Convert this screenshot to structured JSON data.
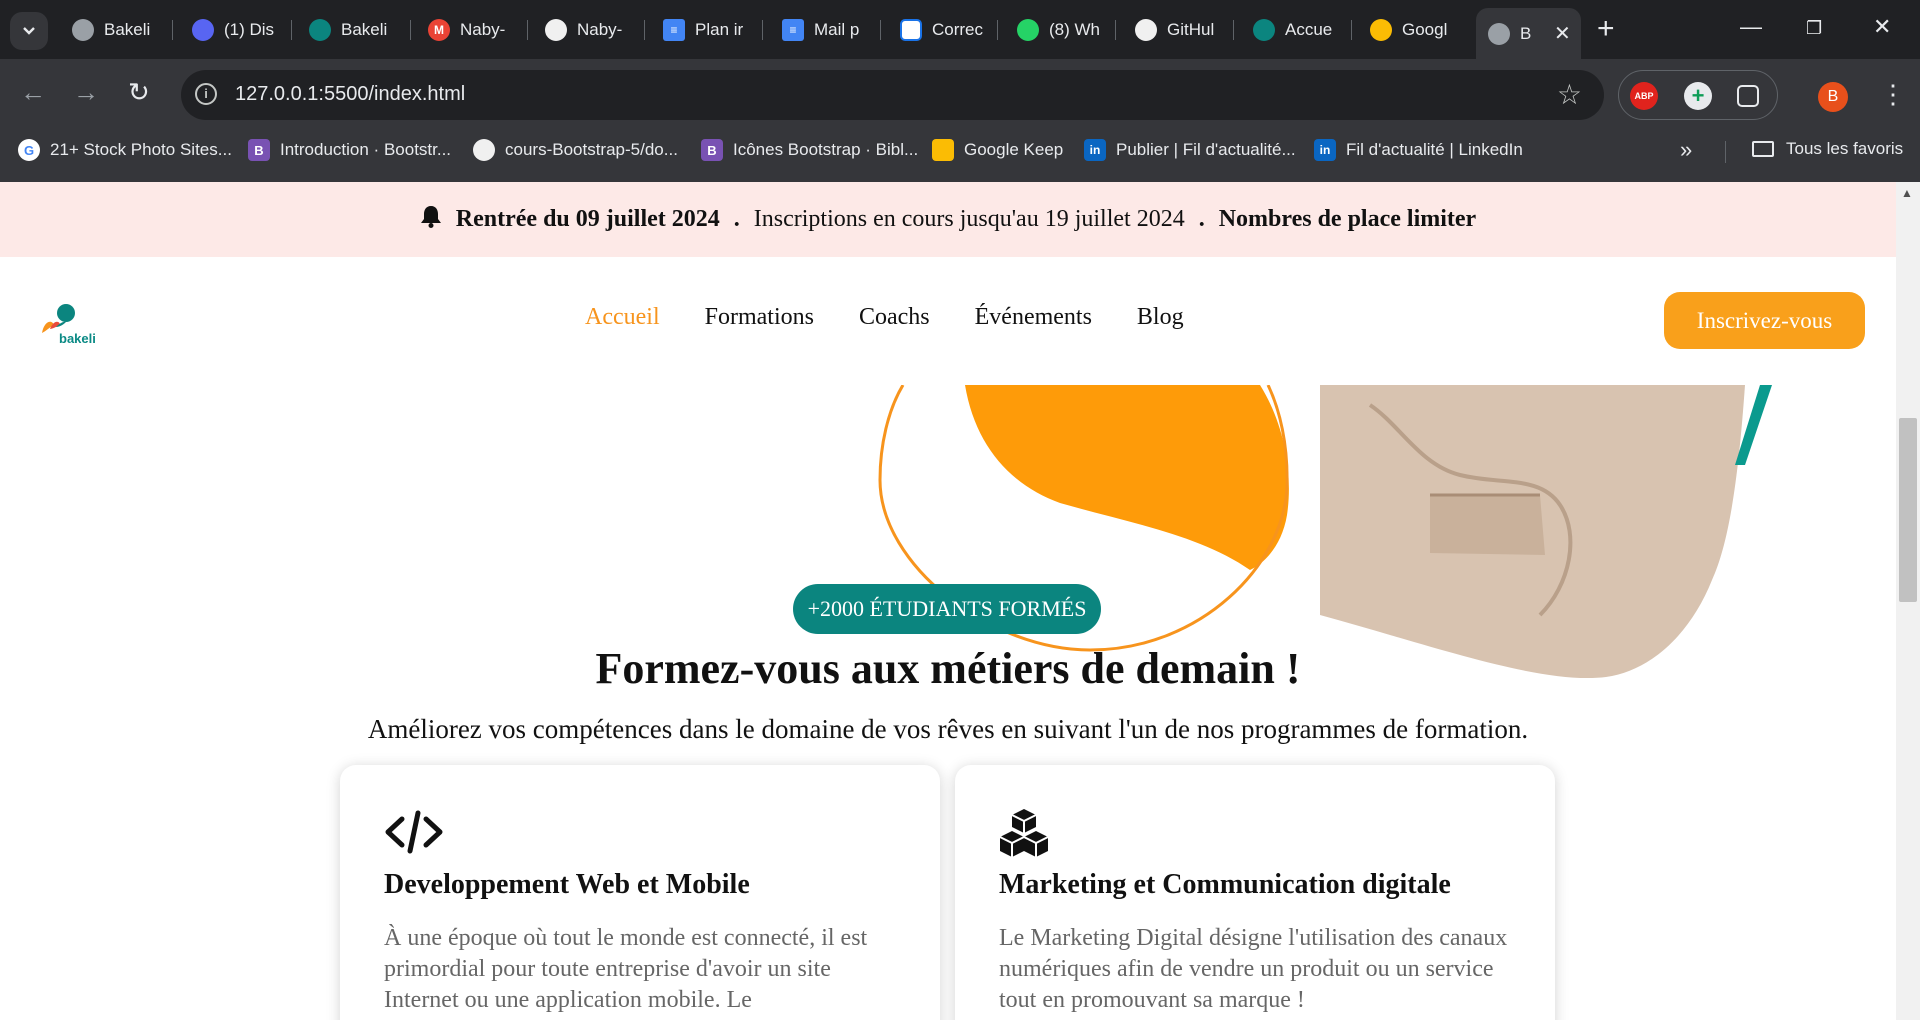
{
  "tabs": [
    {
      "label": "Bakeli",
      "icon": "globe-icon"
    },
    {
      "label": "(1) Dis",
      "icon": "discord-icon"
    },
    {
      "label": "Bakeli",
      "icon": "bakeli-icon"
    },
    {
      "label": "Naby-",
      "icon": "gmail-icon"
    },
    {
      "label": "Naby-",
      "icon": "github-icon"
    },
    {
      "label": "Plan ir",
      "icon": "docs-icon"
    },
    {
      "label": "Mail p",
      "icon": "docs-icon"
    },
    {
      "label": "Correc",
      "icon": "reverso-icon"
    },
    {
      "label": "(8) Wh",
      "icon": "whatsapp-icon"
    },
    {
      "label": "GitHul",
      "icon": "github-icon"
    },
    {
      "label": "Accue",
      "icon": "bakeli-icon"
    },
    {
      "label": "Googl",
      "icon": "google-lens-icon"
    },
    {
      "label": "B",
      "icon": "globe-icon"
    }
  ],
  "toolbar": {
    "url": "127.0.0.1:5500/index.html",
    "profile_initial": "B",
    "abp_label": "ABP"
  },
  "bookmarks": [
    {
      "label": "21+ Stock Photo Sites...",
      "icon": "google-icon",
      "color": "#ffffff"
    },
    {
      "label": "Introduction · Bootstr...",
      "icon": "bootstrap-icon",
      "color": "#7952b3"
    },
    {
      "label": "cours-Bootstrap-5/do...",
      "icon": "github-icon",
      "color": "#ffffff"
    },
    {
      "label": "Icônes Bootstrap · Bibl...",
      "icon": "bootstrap-icon",
      "color": "#7952b3"
    },
    {
      "label": "Google Keep",
      "icon": "keep-icon",
      "color": "#fbbc04"
    },
    {
      "label": "Publier | Fil d'actualité...",
      "icon": "linkedin-icon",
      "color": "#0a66c2"
    },
    {
      "label": "Fil d'actualité | LinkedIn",
      "icon": "linkedin-icon",
      "color": "#0a66c2"
    }
  ],
  "all_bookmarks": "Tous les favoris",
  "announcement": {
    "part1": "Rentrée du 09 juillet 2024",
    "part2": "Inscriptions en cours jusqu'au 19 juillet 2024",
    "part3": "Nombres de place limiter"
  },
  "nav": {
    "logo_text": "bakeli",
    "links": [
      "Accueil",
      "Formations",
      "Coachs",
      "Événements",
      "Blog"
    ],
    "cta": "Inscrivez-vous"
  },
  "hero": {
    "badge": "+2000 ÉTUDIANTS FORMÉS",
    "title": "Formez-vous aux métiers de demain !",
    "subtitle": "Améliorez vos compétences dans le domaine de vos rêves en suivant l'un de nos programmes de formation."
  },
  "cards": [
    {
      "icon": "code-icon",
      "title": "Developpement Web et Mobile",
      "text": "À une époque où tout le monde est connecté, il est primordial pour toute entreprise d'avoir un site Internet ou une application mobile. Le"
    },
    {
      "icon": "boxes-icon",
      "title": "Marketing et Communication digitale",
      "text": "Le Marketing Digital désigne l'utilisation des canaux numériques afin de vendre un produit ou un service tout en promouvant sa marque !"
    }
  ],
  "colors": {
    "accent_orange": "#f7941d",
    "teal": "#0b857f",
    "announcement_bg": "#fde9e7"
  }
}
